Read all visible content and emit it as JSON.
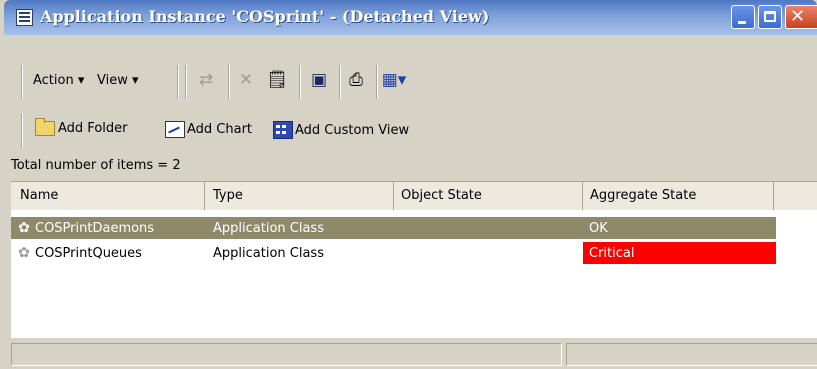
{
  "window": {
    "title": "Application Instance 'COSprint' - (Detached View)",
    "controls": [
      "minimize-icon",
      "maximize-icon",
      "close-icon"
    ]
  },
  "toolbar": {
    "menus": [
      {
        "label": "Action",
        "arrow": "▾"
      },
      {
        "label": "View",
        "arrow": "▾"
      }
    ],
    "icons": [
      "arrows-icon",
      "delete-icon",
      "properties-icon",
      "save-icon",
      "print-icon",
      "view-options-icon"
    ]
  },
  "actions": {
    "add_folder": "Add Folder",
    "add_chart": "Add Chart",
    "add_custom_view": "Add Custom View"
  },
  "list": {
    "total_label": "Total number of items = 2",
    "columns": [
      "Name",
      "Type",
      "Object State",
      "Aggregate State"
    ],
    "rows": [
      {
        "name": "COSPrintDaemons",
        "type": "Application Class",
        "object_state": "",
        "aggregate_state": "OK",
        "state_color": "#8d8a69",
        "selected": true
      },
      {
        "name": "COSPrintQueues",
        "type": "Application Class",
        "object_state": "",
        "aggregate_state": "Critical",
        "state_color": "#ff0000",
        "selected": false
      }
    ]
  },
  "colors": {
    "title_bar": "#4f78c2",
    "selection": "#8d8a69",
    "critical": "#ff0000"
  }
}
